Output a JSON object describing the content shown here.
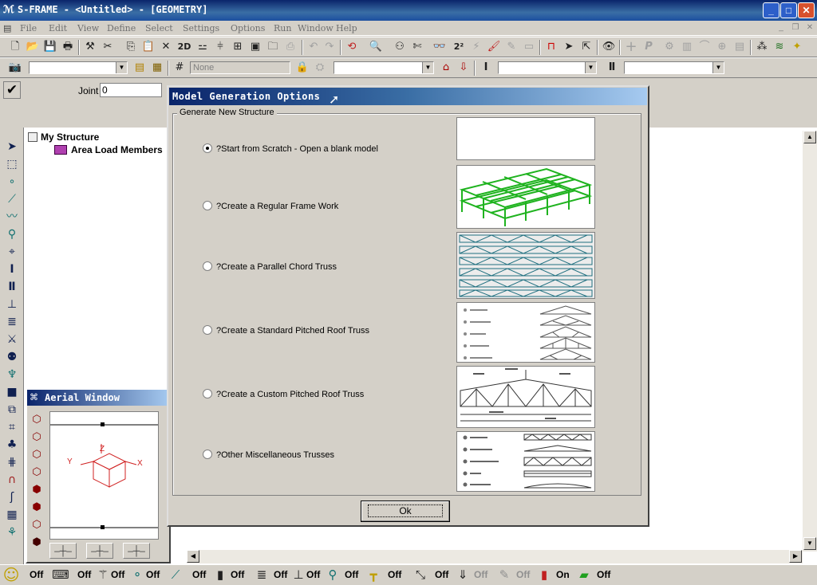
{
  "window": {
    "title": "S-FRAME - <Untitled> - [GEOMETRY]",
    "app_icon": "app-icon",
    "min": "_",
    "max": "□",
    "close": "✕"
  },
  "menu": [
    "File",
    "Edit",
    "View",
    "Define",
    "Select",
    "Settings",
    "Options",
    "Run",
    "Window",
    "Help"
  ],
  "toolbar2": {
    "layer_combo": "None"
  },
  "joint": {
    "label": "Joint",
    "value": "0"
  },
  "tree": {
    "root": "My Structure",
    "child": "Area Load Members"
  },
  "aerial": {
    "title": "Aerial Window",
    "axis_y": "Y",
    "axis_x": "X",
    "axis_z": "Z"
  },
  "dialog": {
    "title": "Model Generation Options",
    "group_label": "Generate New Structure",
    "options": [
      {
        "label": "?Start from Scratch - Open a blank model",
        "selected": true
      },
      {
        "label": "?Create a Regular Frame Work",
        "selected": false
      },
      {
        "label": "?Create a Parallel Chord Truss",
        "selected": false
      },
      {
        "label": "?Create a Standard Pitched Roof Truss",
        "selected": false
      },
      {
        "label": "?Create a Custom Pitched Roof Truss",
        "selected": false
      },
      {
        "label": "?Other Miscellaneous Trusses",
        "selected": false
      }
    ],
    "ok": "Ok"
  },
  "status": [
    {
      "state": "Off"
    },
    {
      "state": "Off"
    },
    {
      "state": "Off"
    },
    {
      "state": "Off"
    },
    {
      "state": "Off"
    },
    {
      "state": "Off"
    },
    {
      "state": "Off"
    },
    {
      "state": "Off"
    },
    {
      "state": "Off"
    },
    {
      "state": "Off"
    },
    {
      "state": "Off"
    },
    {
      "state": "Off"
    },
    {
      "state": "Off"
    },
    {
      "state": "Off"
    },
    {
      "state": "On"
    },
    {
      "state": "Off"
    }
  ],
  "colors": {
    "title_bar": "#0a246a",
    "frame_green": "#22aa22",
    "roof_red": "#cc2222"
  }
}
